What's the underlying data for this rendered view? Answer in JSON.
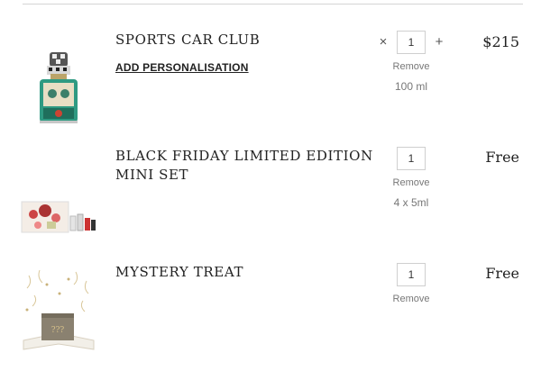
{
  "cart": {
    "items": [
      {
        "title": "SPORTS CAR CLUB",
        "personalise_label": "ADD PERSONALISATION",
        "qty_minus": "×",
        "qty_plus": "+",
        "quantity": "1",
        "remove_label": "Remove",
        "size": "100 ml",
        "price": "$215"
      },
      {
        "title": "BLACK FRIDAY LIMITED EDITION MINI SET",
        "quantity": "1",
        "remove_label": "Remove",
        "size": "4 x 5ml",
        "price": "Free"
      },
      {
        "title": "MYSTERY TREAT",
        "quantity": "1",
        "remove_label": "Remove",
        "price": "Free",
        "box_label": "???"
      }
    ]
  },
  "colors": {
    "divider": "#d4d4d4",
    "bottle_glass": "#2f9a82",
    "gold": "#b89b5e"
  },
  "icons": [
    "perfume-bottle-image",
    "mini-set-image",
    "mystery-box-image"
  ]
}
